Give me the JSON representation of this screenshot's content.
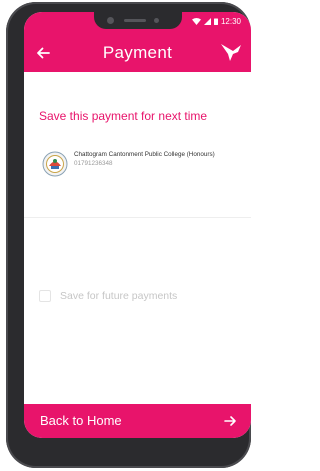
{
  "status_bar": {
    "time": "12:30",
    "icons": [
      "wifi-icon",
      "signal-icon",
      "battery-icon"
    ]
  },
  "header": {
    "title": "Payment",
    "back_icon": "arrow-left-icon",
    "logo_icon": "bird-logo-icon"
  },
  "main": {
    "section_title": "Save this payment for next time",
    "institution": {
      "name": "Chattogram Cantonment Public College (Honours)",
      "account": "01791236348",
      "logo_icon": "college-crest-icon"
    },
    "save_option": {
      "label": "Save for future payments",
      "checked": false
    }
  },
  "footer": {
    "button_label": "Back to Home",
    "arrow_icon": "arrow-right-icon"
  },
  "colors": {
    "accent": "#e8146b",
    "phone_body": "#2b2b2e"
  }
}
